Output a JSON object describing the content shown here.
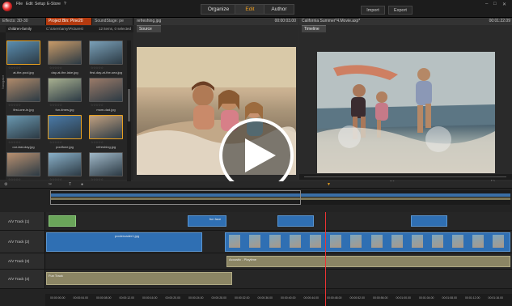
{
  "menu": [
    "File",
    "Edit",
    "Setup",
    "E-Store"
  ],
  "nav": {
    "organize": "Organize",
    "edit": "Edit",
    "author": "Author"
  },
  "top_buttons": {
    "import": "Import",
    "export": "Export"
  },
  "library": {
    "tabs": [
      "Effects: 3D-30",
      "Project Bin: Pine20",
      "SoundStage: pe"
    ],
    "collection": "children-family",
    "path": "C:\\Users\\amy\\Pictures\\",
    "count": "12 items, 0 selected",
    "side_label": "Navigator",
    "thumbs": [
      {
        "label": "at-the-pool.jpg",
        "selected": true
      },
      {
        "label": "day-at-the-lake.jpg",
        "selected": false
      },
      {
        "label": "first-day-at-the-sea.jpg",
        "selected": false
      },
      {
        "label": "first-one-in.jpg",
        "selected": false
      },
      {
        "label": "fun-times.jpg",
        "selected": false
      },
      {
        "label": "mom-dad.jpg",
        "selected": false
      },
      {
        "label": "our-last-day.jpg",
        "selected": false
      },
      {
        "label": "poolfone.jpg",
        "selected": true
      },
      {
        "label": "refreshing.jpg",
        "selected": true
      },
      {
        "label": "sisters.jpg",
        "selected": false
      },
      {
        "label": "sisters-running.jpg",
        "selected": false
      },
      {
        "label": "windy-day.jpg",
        "selected": false
      }
    ]
  },
  "source": {
    "file": "refreshing.jpg",
    "time": "00:00:03.00",
    "tab": "Source"
  },
  "viewer": {
    "file": "California Summer*4.Movie.axp*",
    "time": "00:01:22.09",
    "tab": "Timeline"
  },
  "tracks": [
    {
      "label": "A/V Track (1)"
    },
    {
      "label": "A/V Track (2)"
    },
    {
      "label": "A/V Track (3)"
    },
    {
      "label": "A/V Track (4)"
    }
  ],
  "clips": {
    "t1": "fun face",
    "t2": "pooleroader1.jpg",
    "t3": "Acoustic - Playtime",
    "t4": "Fun Track"
  },
  "ruler": [
    "00:00:00.00",
    "00:00:04.00",
    "00:00:08.00",
    "00:00:12.00",
    "00:00:16.00",
    "00:00:20.00",
    "00:00:24.00",
    "00:00:28.00",
    "00:00:32.00",
    "00:00:36.00",
    "00:00:40.00",
    "00:00:44.00",
    "00:00:48.00",
    "00:00:52.00",
    "00:00:56.00",
    "00:01:00.00",
    "00:01:04.00",
    "00:01:08.00",
    "00:01:12.00",
    "00:01:16.00"
  ],
  "colors": {
    "accent": "#e8a020",
    "clip_video": "#2f6fb3",
    "clip_audio": "#8b8564",
    "playhead": "#ee3333"
  }
}
